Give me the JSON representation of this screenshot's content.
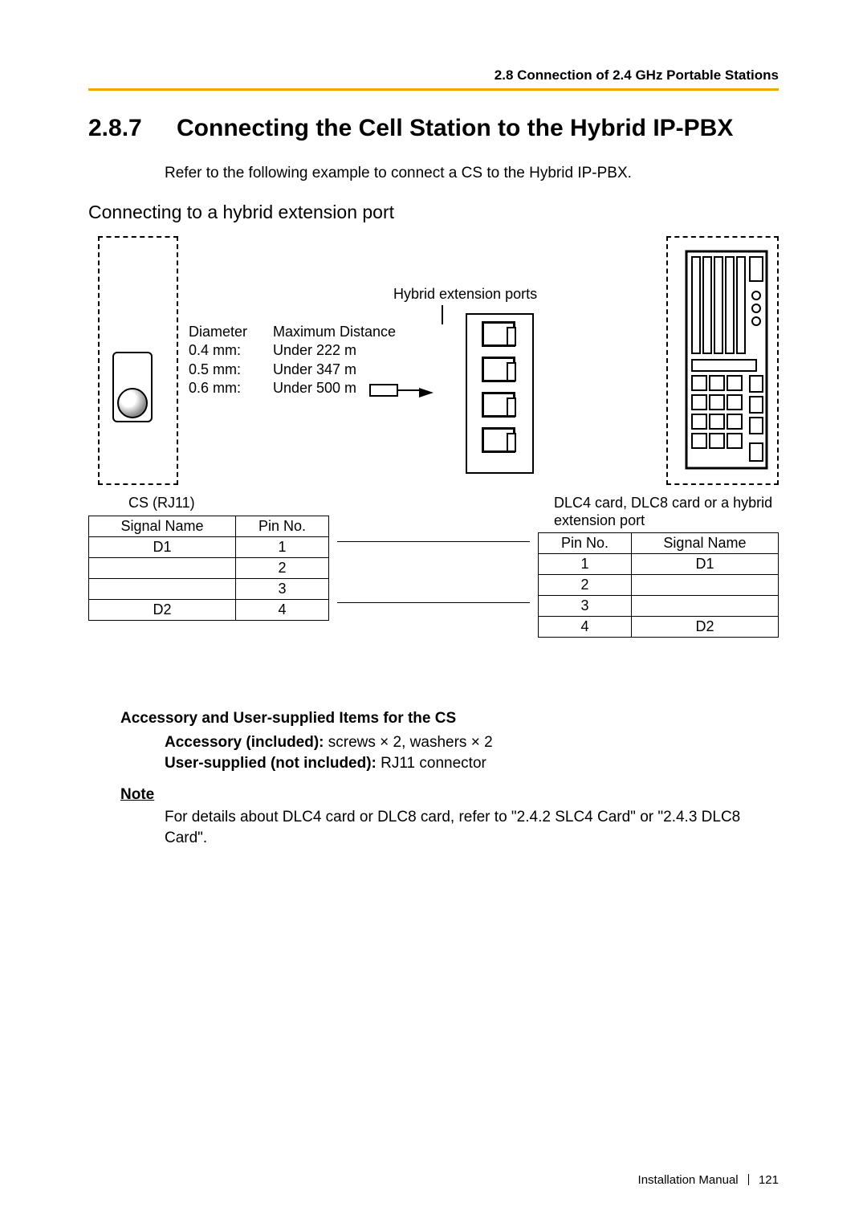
{
  "running_head": "2.8 Connection of 2.4 GHz Portable Stations",
  "section": {
    "number": "2.8.7",
    "title": "Connecting the Cell Station to the Hybrid IP-PBX"
  },
  "intro": "Refer to the following example to connect a CS to the Hybrid IP-PBX.",
  "h2": "Connecting to a hybrid extension port",
  "diagram": {
    "hep_label": "Hybrid extension ports",
    "cable": {
      "header": {
        "diam": "Diameter",
        "dist": "Maximum Distance"
      },
      "rows": [
        {
          "diam": "0.4 mm:",
          "dist": "Under 222 m"
        },
        {
          "diam": "0.5 mm:",
          "dist": "Under 347 m"
        },
        {
          "diam": "0.6 mm:",
          "dist": "Under 500 m"
        }
      ]
    }
  },
  "pins": {
    "left_caption": "CS (RJ11)",
    "right_caption": "DLC4 card, DLC8 card or a hybrid extension port",
    "headers": {
      "signal": "Signal Name",
      "pin": "Pin No."
    },
    "left": [
      {
        "signal": "D1",
        "pin": "1"
      },
      {
        "signal": "",
        "pin": "2"
      },
      {
        "signal": "",
        "pin": "3"
      },
      {
        "signal": "D2",
        "pin": "4"
      }
    ],
    "right": [
      {
        "pin": "1",
        "signal": "D1"
      },
      {
        "pin": "2",
        "signal": ""
      },
      {
        "pin": "3",
        "signal": ""
      },
      {
        "pin": "4",
        "signal": "D2"
      }
    ]
  },
  "accessory": {
    "heading": "Accessory and User-supplied Items for the CS",
    "included_label": "Accessory (included):",
    "included_value": " screws × 2, washers × 2",
    "user_label": "User-supplied (not included):",
    "user_value": " RJ11 connector"
  },
  "note": {
    "label": "Note",
    "text": "For details about DLC4 card or DLC8 card, refer to \"2.4.2 SLC4 Card\" or \"2.4.3 DLC8 Card\"."
  },
  "footer": {
    "manual": "Installation Manual",
    "page": "121"
  }
}
